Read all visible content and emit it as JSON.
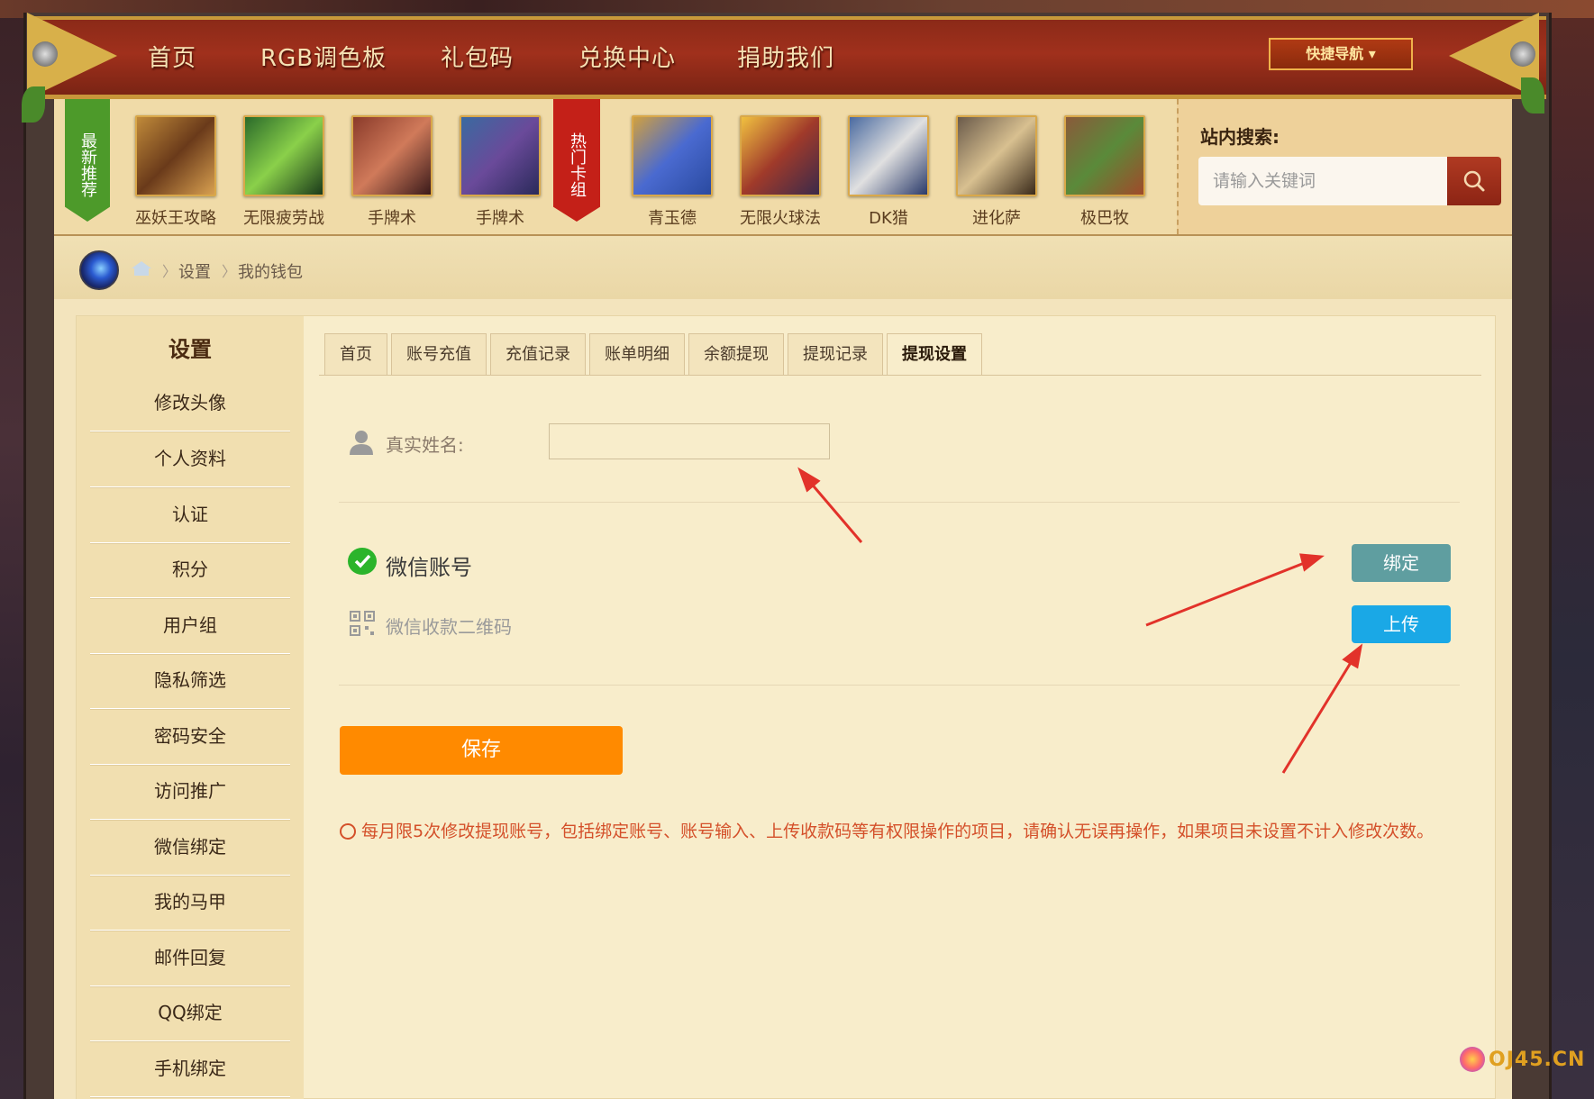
{
  "nav": {
    "items": [
      "首页",
      "RGB调色板",
      "礼包码",
      "兑换中心",
      "捐助我们"
    ],
    "quick_nav": "快捷导航 ▾"
  },
  "recommend": {
    "latest_label": "最新推荐",
    "hot_label": "热门卡组",
    "latest": [
      "巫妖王攻略",
      "无限疲劳战",
      "手牌术",
      "手牌术"
    ],
    "hot": [
      "青玉德",
      "无限火球法",
      "DK猎",
      "进化萨",
      "极巴牧"
    ]
  },
  "search": {
    "label": "站内搜索:",
    "placeholder": "请输入关键词"
  },
  "breadcrumb": {
    "items": [
      "设置",
      "我的钱包"
    ]
  },
  "sidebar": {
    "title": "设置",
    "items": [
      "修改头像",
      "个人资料",
      "认证",
      "积分",
      "用户组",
      "隐私筛选",
      "密码安全",
      "访问推广",
      "微信绑定",
      "我的马甲",
      "邮件回复",
      "QQ绑定",
      "手机绑定"
    ]
  },
  "tabs": {
    "items": [
      "首页",
      "账号充值",
      "充值记录",
      "账单明细",
      "余额提现",
      "提现记录",
      "提现设置"
    ],
    "active_index": 6
  },
  "form": {
    "real_name_label": "真实姓名:",
    "real_name_value": "",
    "wechat_label": "微信账号",
    "wechat_qr_label": "微信收款二维码",
    "bind_button": "绑定",
    "upload_button": "上传",
    "save_button": "保存",
    "notice": "每月限5次修改提现账号，包括绑定账号、账号输入、上传收款码等有权限操作的项目，请确认无误再操作，如果项目未设置不计入修改次数。"
  },
  "watermark": "OJ45.CN",
  "colors": {
    "nav_red": "#a0301c",
    "save_orange": "#ff8a00",
    "bind_teal": "#5f9ea0",
    "upload_blue": "#1aa8e6",
    "notice_red": "#d4502a",
    "wechat_green": "#2bb42b"
  },
  "icons": {
    "search": "search-icon",
    "home": "home-icon",
    "user": "user-icon",
    "wechat": "wechat-icon",
    "qr": "qrcode-icon"
  }
}
